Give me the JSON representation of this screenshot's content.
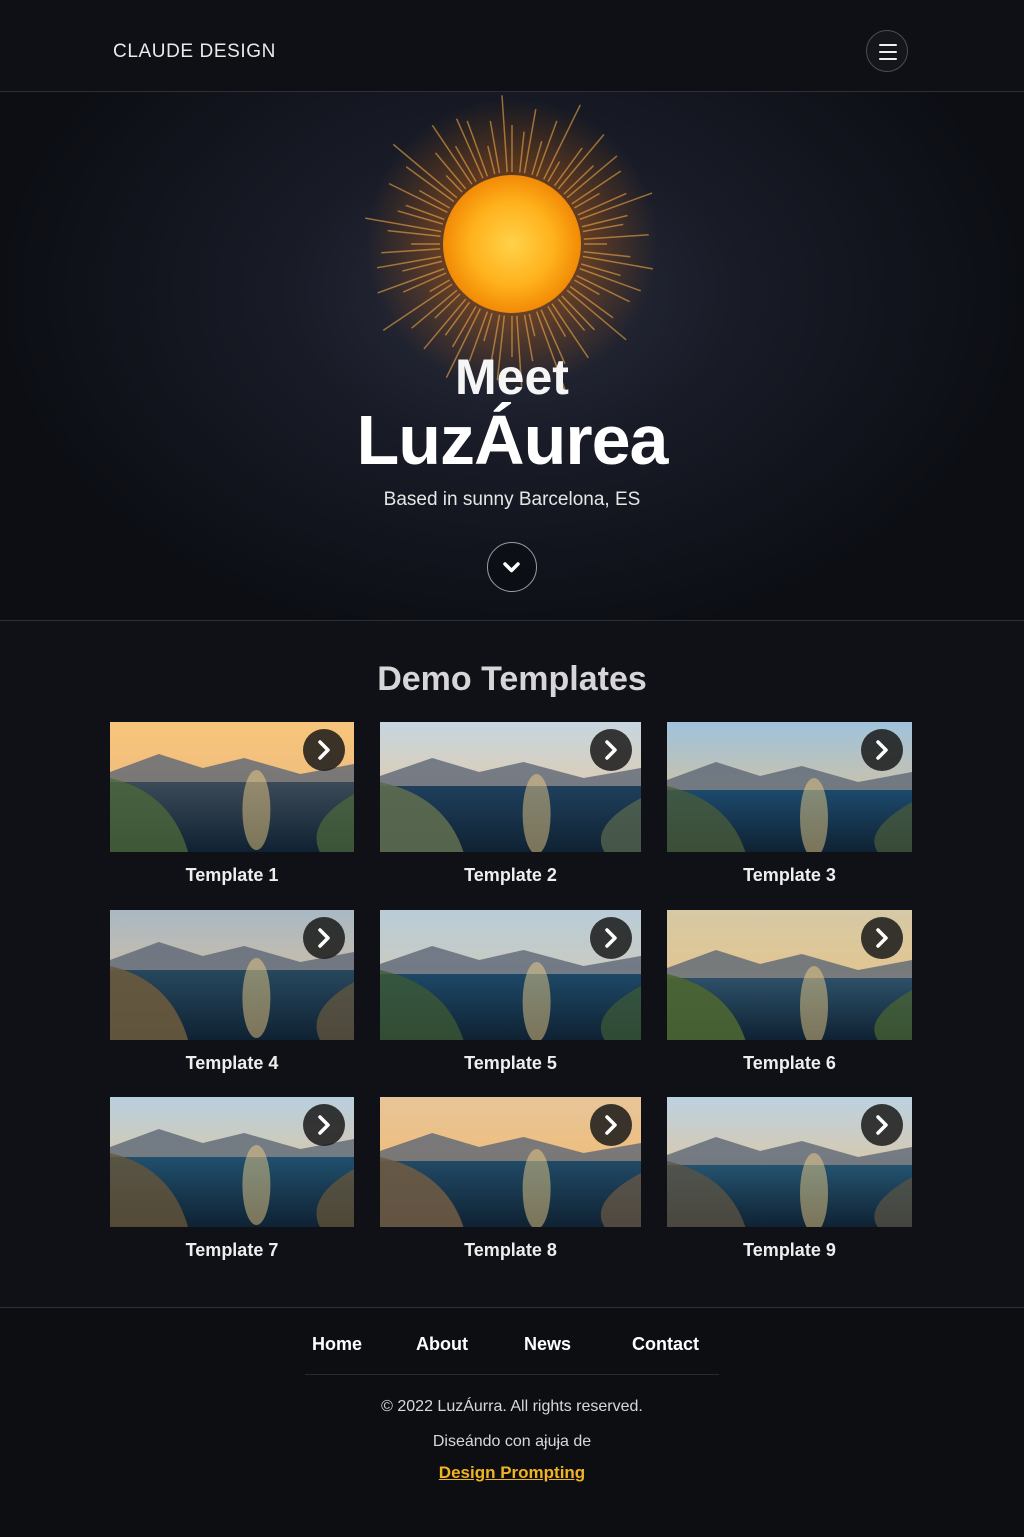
{
  "header": {
    "brand": "CLAUDE DESIGN",
    "menu_icon": "hamburger-menu-icon"
  },
  "hero": {
    "eyebrow": "Meet",
    "title": "LuzÁurea",
    "subtitle": "Based in sunny Barcelona, ES",
    "scroll_icon": "chevron-down-icon",
    "sun_color": "#f9a51a"
  },
  "templates": {
    "heading": "Demo Templates",
    "items": [
      {
        "label": "Template 1"
      },
      {
        "label": "Template 2"
      },
      {
        "label": "Template 3"
      },
      {
        "label": "Template 4"
      },
      {
        "label": "Template 5"
      },
      {
        "label": "Template 6"
      },
      {
        "label": "Template 7"
      },
      {
        "label": "Template 8"
      },
      {
        "label": "Template 9"
      }
    ],
    "arrow_icon": "chevron-right-icon"
  },
  "footer": {
    "nav": [
      "Home",
      "About",
      "News",
      "Contact"
    ],
    "copyright": "© 2022 LuzÁurra. All rights reserved.",
    "made_with": "Diseándo con aɉuɉa de",
    "credit": "Design Prompting",
    "accent": "#f2b322"
  }
}
